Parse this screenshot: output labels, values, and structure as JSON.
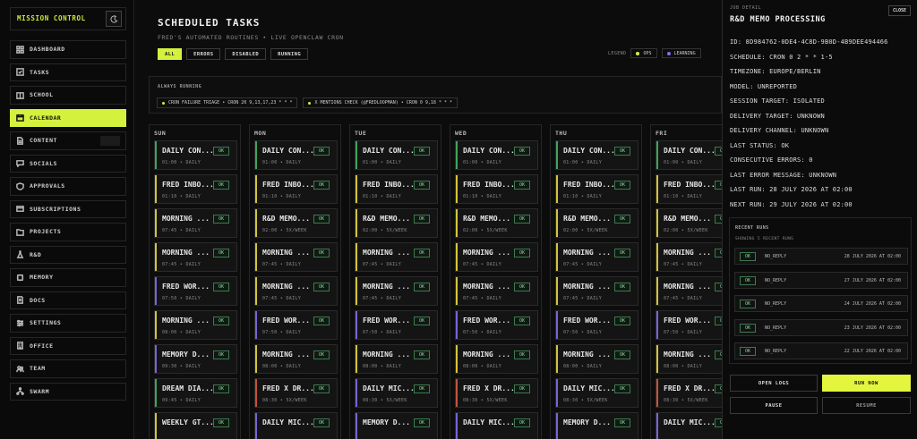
{
  "app": {
    "title": "MISSION CONTROL"
  },
  "sidebar": {
    "items": [
      {
        "label": "DASHBOARD",
        "icon": "grid-icon",
        "active": false
      },
      {
        "label": "TASKS",
        "icon": "checkbox-icon",
        "active": false
      },
      {
        "label": "SCHOOL",
        "icon": "book-icon",
        "active": false
      },
      {
        "label": "CALENDAR",
        "icon": "calendar-icon",
        "active": true
      },
      {
        "label": "CONTENT",
        "icon": "document-icon",
        "active": false
      },
      {
        "label": "SOCIALS",
        "icon": "chat-icon",
        "active": false
      },
      {
        "label": "APPROVALS",
        "icon": "shield-icon",
        "active": false
      },
      {
        "label": "SUBSCRIPTIONS",
        "icon": "card-icon",
        "active": false
      },
      {
        "label": "PROJECTS",
        "icon": "folder-icon",
        "active": false
      },
      {
        "label": "R&D",
        "icon": "flask-icon",
        "active": false
      },
      {
        "label": "MEMORY",
        "icon": "chip-icon",
        "active": false
      },
      {
        "label": "DOCS",
        "icon": "docs-icon",
        "active": false
      },
      {
        "label": "SETTINGS",
        "icon": "sliders-icon",
        "active": false
      },
      {
        "label": "OFFICE",
        "icon": "building-icon",
        "active": false
      },
      {
        "label": "TEAM",
        "icon": "team-icon",
        "active": false
      },
      {
        "label": "SWARM",
        "icon": "network-icon",
        "active": false
      }
    ]
  },
  "header": {
    "title": "SCHEDULED TASKS",
    "subtitle": "FRED'S AUTOMATED ROUTINES • LIVE OPENCLAW CRON"
  },
  "filters": [
    "ALL",
    "ERRORS",
    "DISABLED",
    "RUNNING"
  ],
  "legend": {
    "label": "LEGEND",
    "items": [
      {
        "label": "OPS",
        "color": "#d4f13d"
      },
      {
        "label": "LEARNING",
        "color": "#8a6cf0"
      }
    ]
  },
  "always_running": {
    "label": "ALWAYS RUNNING",
    "items": [
      "CRON FAILURE TRIAGE • CRON 20 9,13,17,23 * * *",
      "X MENTIONS CHECK (@FREDLOOPMAN) • CRON 0 9,18 * * *"
    ]
  },
  "days": [
    {
      "label": "SUN",
      "tasks": [
        {
          "name": "DAILY CON...",
          "meta": "01:00 • DAILY",
          "status": "OK",
          "color": "#3fa35c"
        },
        {
          "name": "FRED INBO...",
          "meta": "01:10 • DAILY",
          "status": "OK",
          "color": "#d4c43a"
        },
        {
          "name": "MORNING ...",
          "meta": "07:45 • DAILY",
          "status": "OK",
          "color": "#d4c43a"
        },
        {
          "name": "MORNING ...",
          "meta": "07:45 • DAILY",
          "status": "OK",
          "color": "#d4c43a"
        },
        {
          "name": "FRED WOR...",
          "meta": "07:50 • DAILY",
          "status": "OK",
          "color": "#7a62d8"
        },
        {
          "name": "MORNING ...",
          "meta": "08:00 • DAILY",
          "status": "OK",
          "color": "#d4c43a"
        },
        {
          "name": "MEMORY D...",
          "meta": "09:30 • DAILY",
          "status": "OK",
          "color": "#7a62d8"
        },
        {
          "name": "DREAM DIA...",
          "meta": "09:45 • DAILY",
          "status": "OK",
          "color": "#3fa35c"
        },
        {
          "name": "WEEKLY GT...",
          "meta": "",
          "status": "OK",
          "color": "#d4c43a"
        }
      ]
    },
    {
      "label": "MON",
      "tasks": [
        {
          "name": "DAILY CON...",
          "meta": "01:00 • DAILY",
          "status": "OK",
          "color": "#3fa35c"
        },
        {
          "name": "FRED INBO...",
          "meta": "01:10 • DAILY",
          "status": "OK",
          "color": "#d4c43a"
        },
        {
          "name": "R&D MEMO...",
          "meta": "02:00 • 5X/WEEK",
          "status": "OK",
          "color": "#d4c43a"
        },
        {
          "name": "MORNING ...",
          "meta": "07:45 • DAILY",
          "status": "OK",
          "color": "#d4c43a"
        },
        {
          "name": "MORNING ...",
          "meta": "07:45 • DAILY",
          "status": "OK",
          "color": "#d4c43a"
        },
        {
          "name": "FRED WOR...",
          "meta": "07:50 • DAILY",
          "status": "OK",
          "color": "#7a62d8"
        },
        {
          "name": "MORNING ...",
          "meta": "08:00 • DAILY",
          "status": "OK",
          "color": "#d4c43a"
        },
        {
          "name": "FRED X DR...",
          "meta": "08:30 • 5X/WEEK",
          "status": "OK",
          "color": "#c4533a"
        },
        {
          "name": "DAILY MIC...",
          "meta": "",
          "status": "OK",
          "color": "#7a62d8"
        }
      ]
    },
    {
      "label": "TUE",
      "tasks": [
        {
          "name": "DAILY CON...",
          "meta": "01:00 • DAILY",
          "status": "OK",
          "color": "#3fa35c"
        },
        {
          "name": "FRED INBO...",
          "meta": "01:10 • DAILY",
          "status": "OK",
          "color": "#d4c43a"
        },
        {
          "name": "R&D MEMO...",
          "meta": "02:00 • 5X/WEEK",
          "status": "OK",
          "color": "#d4c43a"
        },
        {
          "name": "MORNING ...",
          "meta": "07:45 • DAILY",
          "status": "OK",
          "color": "#d4c43a"
        },
        {
          "name": "MORNING ...",
          "meta": "07:45 • DAILY",
          "status": "OK",
          "color": "#d4c43a"
        },
        {
          "name": "FRED WOR...",
          "meta": "07:50 • DAILY",
          "status": "OK",
          "color": "#7a62d8"
        },
        {
          "name": "MORNING ...",
          "meta": "08:00 • DAILY",
          "status": "OK",
          "color": "#d4c43a"
        },
        {
          "name": "DAILY MIC...",
          "meta": "08:30 • 5X/WEEK",
          "status": "OK",
          "color": "#7a62d8"
        },
        {
          "name": "MEMORY D...",
          "meta": "",
          "status": "OK",
          "color": "#7a62d8"
        }
      ]
    },
    {
      "label": "WED",
      "tasks": [
        {
          "name": "DAILY CON...",
          "meta": "01:00 • DAILY",
          "status": "OK",
          "color": "#3fa35c"
        },
        {
          "name": "FRED INBO...",
          "meta": "01:10 • DAILY",
          "status": "OK",
          "color": "#d4c43a"
        },
        {
          "name": "R&D MEMO...",
          "meta": "02:00 • 5X/WEEK",
          "status": "OK",
          "color": "#d4c43a"
        },
        {
          "name": "MORNING ...",
          "meta": "07:45 • DAILY",
          "status": "OK",
          "color": "#d4c43a"
        },
        {
          "name": "MORNING ...",
          "meta": "07:45 • DAILY",
          "status": "OK",
          "color": "#d4c43a"
        },
        {
          "name": "FRED WOR...",
          "meta": "07:50 • DAILY",
          "status": "OK",
          "color": "#7a62d8"
        },
        {
          "name": "MORNING ...",
          "meta": "08:00 • DAILY",
          "status": "OK",
          "color": "#d4c43a"
        },
        {
          "name": "FRED X DR...",
          "meta": "08:30 • 5X/WEEK",
          "status": "OK",
          "color": "#c4533a"
        },
        {
          "name": "DAILY MIC...",
          "meta": "",
          "status": "OK",
          "color": "#7a62d8"
        }
      ]
    },
    {
      "label": "THU",
      "tasks": [
        {
          "name": "DAILY CON...",
          "meta": "01:00 • DAILY",
          "status": "OK",
          "color": "#3fa35c"
        },
        {
          "name": "FRED INBO...",
          "meta": "01:10 • DAILY",
          "status": "OK",
          "color": "#d4c43a"
        },
        {
          "name": "R&D MEMO...",
          "meta": "02:00 • 5X/WEEK",
          "status": "OK",
          "color": "#d4c43a"
        },
        {
          "name": "MORNING ...",
          "meta": "07:45 • DAILY",
          "status": "OK",
          "color": "#d4c43a"
        },
        {
          "name": "MORNING ...",
          "meta": "07:45 • DAILY",
          "status": "OK",
          "color": "#d4c43a"
        },
        {
          "name": "FRED WOR...",
          "meta": "07:50 • DAILY",
          "status": "OK",
          "color": "#7a62d8"
        },
        {
          "name": "MORNING ...",
          "meta": "08:00 • DAILY",
          "status": "OK",
          "color": "#d4c43a"
        },
        {
          "name": "DAILY MIC...",
          "meta": "08:30 • 5X/WEEK",
          "status": "OK",
          "color": "#7a62d8"
        },
        {
          "name": "MEMORY D...",
          "meta": "",
          "status": "OK",
          "color": "#7a62d8"
        }
      ]
    },
    {
      "label": "FRI",
      "tasks": [
        {
          "name": "DAILY CON...",
          "meta": "01:00 • DAILY",
          "status": "OK",
          "color": "#3fa35c"
        },
        {
          "name": "FRED INBO...",
          "meta": "01:10 • DAILY",
          "status": "OK",
          "color": "#d4c43a"
        },
        {
          "name": "R&D MEMO...",
          "meta": "02:00 • 5X/WEEK",
          "status": "OK",
          "color": "#d4c43a"
        },
        {
          "name": "MORNING ...",
          "meta": "07:45 • DAILY",
          "status": "OK",
          "color": "#d4c43a"
        },
        {
          "name": "MORNING ...",
          "meta": "07:45 • DAILY",
          "status": "OK",
          "color": "#d4c43a"
        },
        {
          "name": "FRED WOR...",
          "meta": "07:50 • DAILY",
          "status": "OK",
          "color": "#7a62d8"
        },
        {
          "name": "MORNING ...",
          "meta": "08:00 • DAILY",
          "status": "OK",
          "color": "#d4c43a"
        },
        {
          "name": "FRED X DR...",
          "meta": "08:30 • 5X/WEEK",
          "status": "OK",
          "color": "#c4533a"
        },
        {
          "name": "DAILY MIC...",
          "meta": "",
          "status": "OK",
          "color": "#7a62d8"
        }
      ]
    }
  ],
  "detail": {
    "kicker": "JOB DETAIL",
    "title": "R&D MEMO PROCESSING",
    "close_label": "CLOSE",
    "rows": [
      "ID: 8D984762-0DE4-4C8D-9B0D-4B9DEE494466",
      "SCHEDULE: CRON 0 2 * * 1-5",
      "TIMEZONE: EUROPE/BERLIN",
      "MODEL: UNREPORTED",
      "SESSION TARGET: ISOLATED",
      "DELIVERY TARGET: UNKNOWN",
      "DELIVERY CHANNEL: UNKNOWN",
      "LAST STATUS: OK",
      "CONSECUTIVE ERRORS: 0",
      "LAST ERROR MESSAGE: UNKNOWN",
      "LAST RUN: 28 JULY 2026 AT 02:00",
      "NEXT RUN: 29 JULY 2026 AT 02:00"
    ],
    "recent_runs": {
      "label": "RECENT RUNS",
      "subtitle": "SHOWING 5 RECENT RUNS",
      "items": [
        {
          "status": "OK",
          "result": "NO_REPLY",
          "time": "28 JULY 2026 AT 02:00"
        },
        {
          "status": "OK",
          "result": "NO_REPLY",
          "time": "27 JULY 2026 AT 02:00"
        },
        {
          "status": "OK",
          "result": "NO_REPLY",
          "time": "24 JULY 2026 AT 02:00"
        },
        {
          "status": "OK",
          "result": "NO_REPLY",
          "time": "23 JULY 2026 AT 02:00"
        },
        {
          "status": "OK",
          "result": "NO_REPLY",
          "time": "22 JULY 2026 AT 02:00"
        }
      ]
    },
    "actions": {
      "open_logs": "OPEN LOGS",
      "run_now": "RUN NOW",
      "pause": "PAUSE",
      "resume": "RESUME"
    }
  }
}
